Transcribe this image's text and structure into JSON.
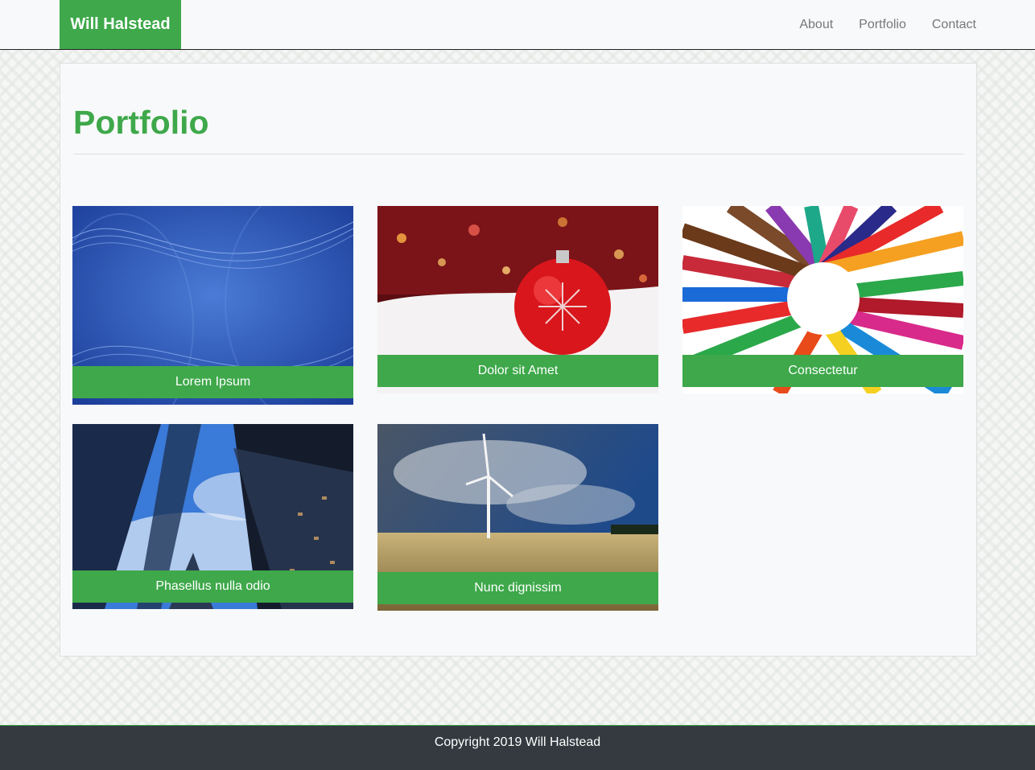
{
  "navbar": {
    "brand": "Will Halstead",
    "links": [
      {
        "label": "About"
      },
      {
        "label": "Portfolio"
      },
      {
        "label": "Contact"
      }
    ]
  },
  "main": {
    "title": "Portfolio",
    "items": [
      {
        "caption": "Lorem Ipsum",
        "image": "blue-abstract-waves"
      },
      {
        "caption": "Dolor sit Amet",
        "image": "red-christmas-ornament"
      },
      {
        "caption": "Consectetur",
        "image": "colored-pencils-circle"
      },
      {
        "caption": "Phasellus nulla odio",
        "image": "skyscrapers-looking-up"
      },
      {
        "caption": "Nunc dignissim",
        "image": "wind-turbine-field"
      }
    ]
  },
  "footer": {
    "text": "Copyright 2019 Will Halstead"
  },
  "colors": {
    "accent": "#3ea84a",
    "footer_bg": "#343a40",
    "nav_bg": "#f8f9fa"
  }
}
